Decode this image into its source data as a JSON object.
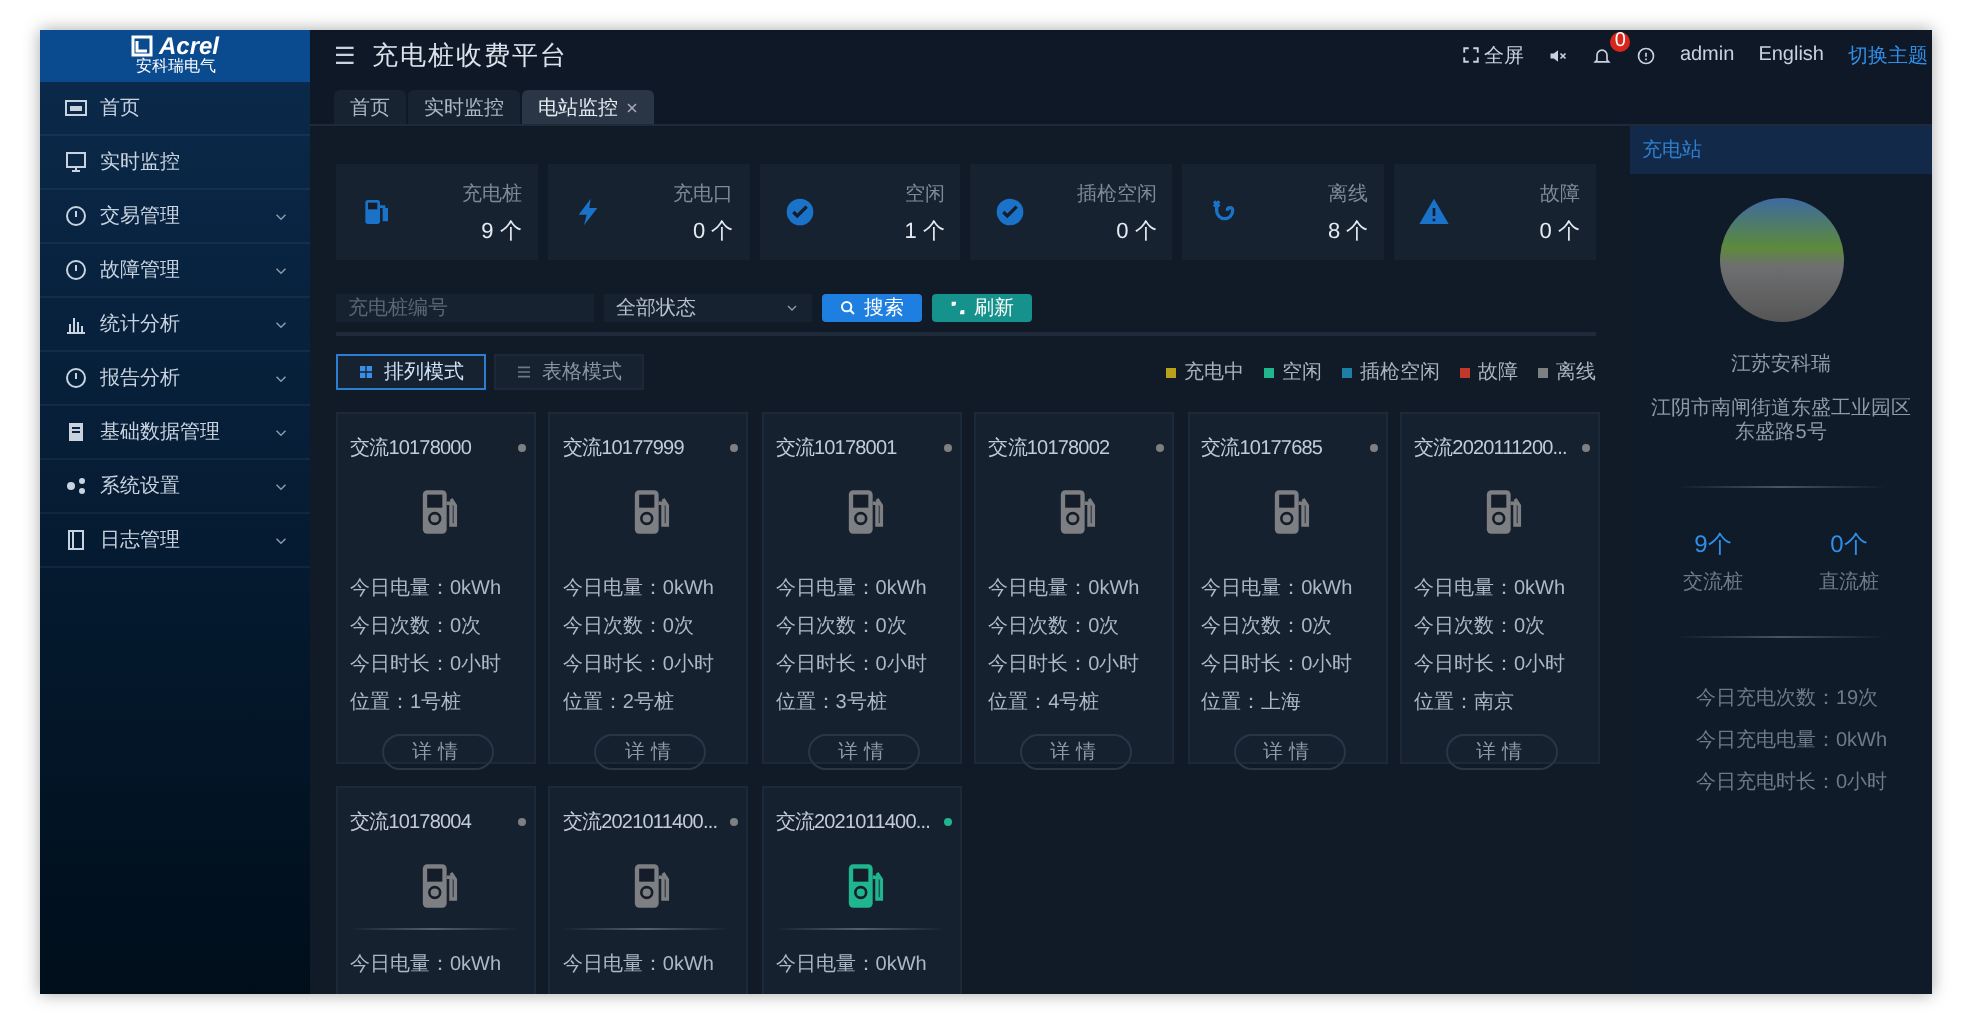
{
  "logo": {
    "brand": "Acrel",
    "subtitle": "安科瑞电气"
  },
  "sidebar": {
    "items": [
      {
        "label": "首页",
        "expandable": false
      },
      {
        "label": "实时监控",
        "expandable": false
      },
      {
        "label": "交易管理",
        "expandable": true
      },
      {
        "label": "故障管理",
        "expandable": true
      },
      {
        "label": "统计分析",
        "expandable": true
      },
      {
        "label": "报告分析",
        "expandable": true
      },
      {
        "label": "基础数据管理",
        "expandable": true
      },
      {
        "label": "系统设置",
        "expandable": true
      },
      {
        "label": "日志管理",
        "expandable": true
      }
    ]
  },
  "header": {
    "menu_icon": "☰",
    "title": "充电桩收费平台",
    "fullscreen": "全屏",
    "badge": "0",
    "user": "admin",
    "language": "English",
    "theme": "切换主题"
  },
  "tabs": [
    {
      "label": "首页",
      "selected": false,
      "closable": false
    },
    {
      "label": "实时监控",
      "selected": false,
      "closable": false
    },
    {
      "label": "电站监控",
      "selected": true,
      "closable": true
    }
  ],
  "stats": [
    {
      "label": "充电桩",
      "value": "9",
      "unit": "个"
    },
    {
      "label": "充电口",
      "value": "0",
      "unit": "个"
    },
    {
      "label": "空闲",
      "value": "1",
      "unit": "个"
    },
    {
      "label": "插枪空闲",
      "value": "0",
      "unit": "个"
    },
    {
      "label": "离线",
      "value": "8",
      "unit": "个"
    },
    {
      "label": "故障",
      "value": "0",
      "unit": "个"
    }
  ],
  "search": {
    "placeholder": "充电桩编号",
    "status_select": "全部状态",
    "search_button": "搜索",
    "refresh_button": "刷新"
  },
  "modes": [
    {
      "label": "排列模式",
      "selected": true
    },
    {
      "label": "表格模式",
      "selected": false
    }
  ],
  "legend": [
    {
      "label": "充电中",
      "color": "#b8a21c"
    },
    {
      "label": "空闲",
      "color": "#1fb58f"
    },
    {
      "label": "插枪空闲",
      "color": "#1d7fa6"
    },
    {
      "label": "故障",
      "color": "#c0392b"
    },
    {
      "label": "离线",
      "color": "#7d7f82"
    }
  ],
  "piles": [
    {
      "name": "交流10178000",
      "color": "#7d7f82",
      "fields": [
        "今日电量：0kWh",
        "今日次数：0次",
        "今日时长：0小时",
        "位置：1号桩"
      ],
      "detail": "详情"
    },
    {
      "name": "交流10177999",
      "color": "#7d7f82",
      "fields": [
        "今日电量：0kWh",
        "今日次数：0次",
        "今日时长：0小时",
        "位置：2号桩"
      ],
      "detail": "详情"
    },
    {
      "name": "交流10178001",
      "color": "#7d7f82",
      "fields": [
        "今日电量：0kWh",
        "今日次数：0次",
        "今日时长：0小时",
        "位置：3号桩"
      ],
      "detail": "详情"
    },
    {
      "name": "交流10178002",
      "color": "#7d7f82",
      "fields": [
        "今日电量：0kWh",
        "今日次数：0次",
        "今日时长：0小时",
        "位置：4号桩"
      ],
      "detail": "详情"
    },
    {
      "name": "交流10177685",
      "color": "#7d7f82",
      "fields": [
        "今日电量：0kWh",
        "今日次数：0次",
        "今日时长：0小时",
        "位置：上海"
      ],
      "detail": "详情"
    },
    {
      "name": "交流2020111200...",
      "color": "#7d7f82",
      "fields": [
        "今日电量：0kWh",
        "今日次数：0次",
        "今日时长：0小时",
        "位置：南京"
      ],
      "detail": "详情"
    },
    {
      "name": "交流10178004",
      "color": "#7d7f82",
      "fields": [
        "今日电量：0kWh"
      ]
    },
    {
      "name": "交流2021011400...",
      "color": "#7d7f82",
      "fields": [
        "今日电量：0kWh"
      ]
    },
    {
      "name": "交流2021011400...",
      "color": "#1fb58f",
      "fields": [
        "今日电量：0kWh"
      ]
    }
  ],
  "station": {
    "title": "充电站",
    "name": "江苏安科瑞",
    "address": "江阴市南闸街道东盛工业园区东盛路5号",
    "counts": [
      {
        "value": "9",
        "unit": "个",
        "label": "交流桩"
      },
      {
        "value": "0",
        "unit": "个",
        "label": "直流桩"
      }
    ],
    "today": [
      "今日充电次数：19次",
      "今日充电电量：0kWh",
      "今日充电时长：0小时"
    ]
  }
}
